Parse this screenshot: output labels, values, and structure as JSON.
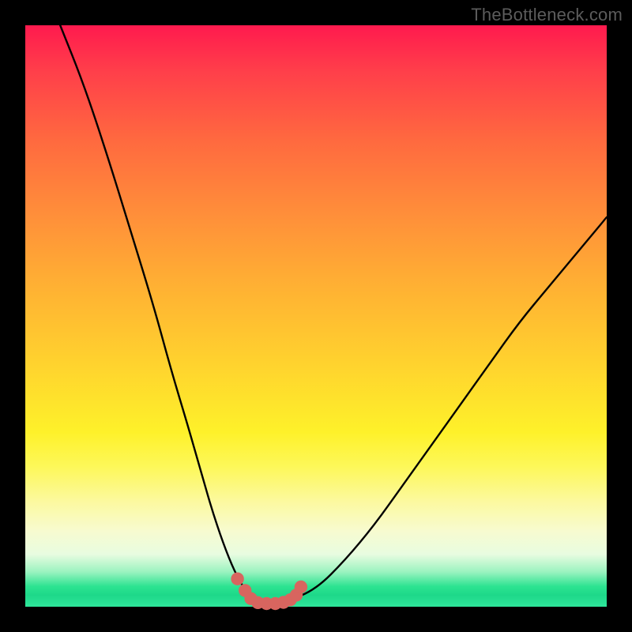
{
  "watermark": "TheBottleneck.com",
  "colors": {
    "page_bg": "#000000",
    "gradient_top": "#ff1a4e",
    "gradient_bottom": "#2fe69b",
    "curve": "#000000",
    "marker": "#d8655f"
  },
  "chart_data": {
    "type": "line",
    "title": "",
    "xlabel": "",
    "ylabel": "",
    "xlim": [
      0,
      100
    ],
    "ylim": [
      0,
      100
    ],
    "grid": false,
    "legend": false,
    "series": [
      {
        "name": "bottleneck-curve",
        "x": [
          6,
          10,
          14,
          18,
          22,
          25,
          28,
          30,
          32,
          34,
          36,
          38,
          39.8,
          41,
          43,
          45,
          50,
          55,
          60,
          65,
          70,
          75,
          80,
          85,
          90,
          95,
          100
        ],
        "values": [
          100,
          90,
          78,
          65,
          52,
          41,
          31,
          24,
          17,
          11,
          6,
          2.5,
          0.9,
          0.6,
          0.6,
          0.9,
          3,
          8,
          14,
          21,
          28,
          35,
          42,
          49,
          55,
          61,
          67
        ]
      }
    ],
    "markers": {
      "name": "valley-dots",
      "x": [
        36.5,
        37.8,
        38.8,
        40.0,
        41.5,
        43.0,
        44.4,
        45.6,
        46.6,
        47.4
      ],
      "values": [
        4.8,
        2.8,
        1.4,
        0.7,
        0.55,
        0.55,
        0.75,
        1.2,
        2.0,
        3.4
      ]
    }
  }
}
